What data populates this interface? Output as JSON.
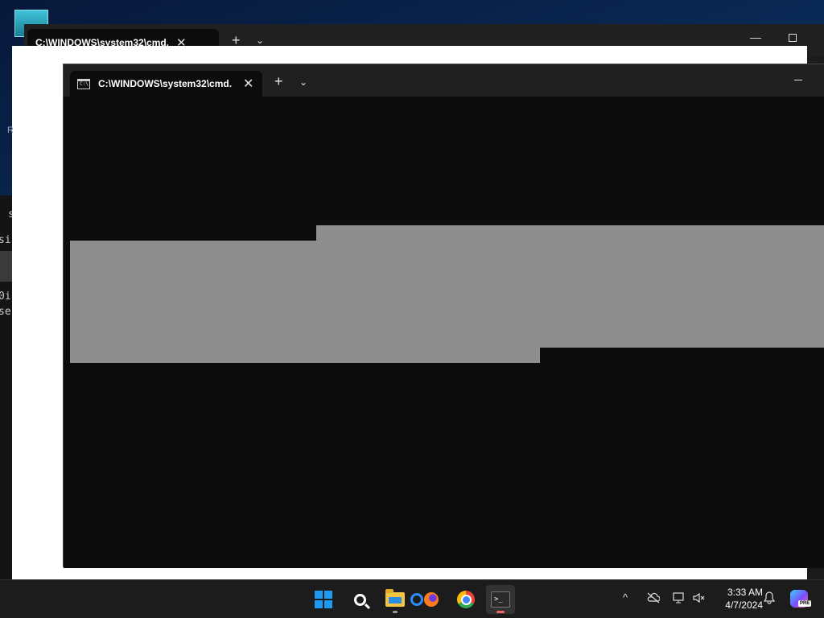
{
  "background_window": {
    "tab_title": "C:\\WINDOWS\\system32\\cmd.",
    "new_tab_symbol": "+",
    "dropdown_symbol": "⌄",
    "close_symbol": "✕",
    "minimize_symbol": "—"
  },
  "side_window": {
    "lines": [
      "s",
      "si",
      "0i",
      "se"
    ],
    "letter": "R"
  },
  "main_window": {
    "tab_title": "C:\\WINDOWS\\system32\\cmd.",
    "cmd_icon_text": "C:\\.",
    "close_symbol": "✕",
    "new_tab_symbol": "+",
    "dropdown_symbol": "⌄"
  },
  "taskbar": {
    "time": "3:33 AM",
    "date": "4/7/2024",
    "tray_chevron": "^",
    "copilot_badge": "PRE",
    "terminal_glyph": ">_"
  },
  "colors": {
    "console_bg": "#0c0c0c",
    "selection": "#8e8e8e",
    "titlebar": "#202020",
    "start_blue": "#1e9bf0"
  }
}
